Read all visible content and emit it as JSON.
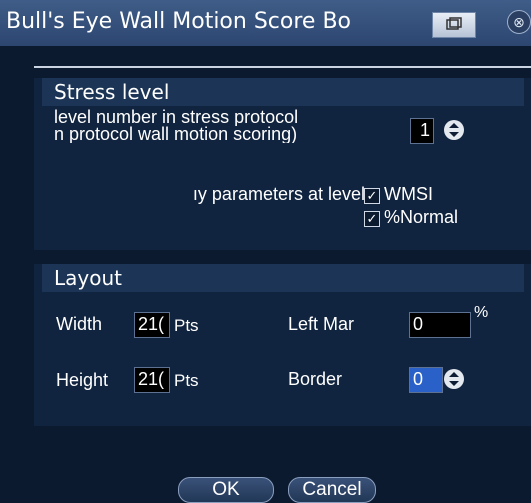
{
  "window": {
    "title": "Bull's Eye Wall Motion Score Bo",
    "restore_icon": "restore-icon",
    "close_glyph": "⊗"
  },
  "stress": {
    "title": "Stress level",
    "line1": "level number in stress protocol",
    "line2": "n protocol wall motion scoring)",
    "level_value": "1",
    "display_label": "ıy parameters at level:",
    "wmsi_label": "WMSI",
    "wmsi_checked": true,
    "normal_label": "%Normal",
    "normal_checked": true
  },
  "layout": {
    "title": "Layout",
    "width_label": "Width",
    "width_value": "21(",
    "width_unit": "Pts",
    "height_label": "Height",
    "height_value": "21(",
    "height_unit": "Pts",
    "left_margin_label": "Left Mar",
    "left_margin_value": "0",
    "left_margin_unit": "%",
    "border_label": "Border",
    "border_value": "0"
  },
  "buttons": {
    "ok": "OK",
    "cancel": "Cancel"
  },
  "colors": {
    "titlebar": "#2c4670",
    "panel": "#0e1d33",
    "group_header": "#1c3556",
    "text": "#ffffff"
  }
}
